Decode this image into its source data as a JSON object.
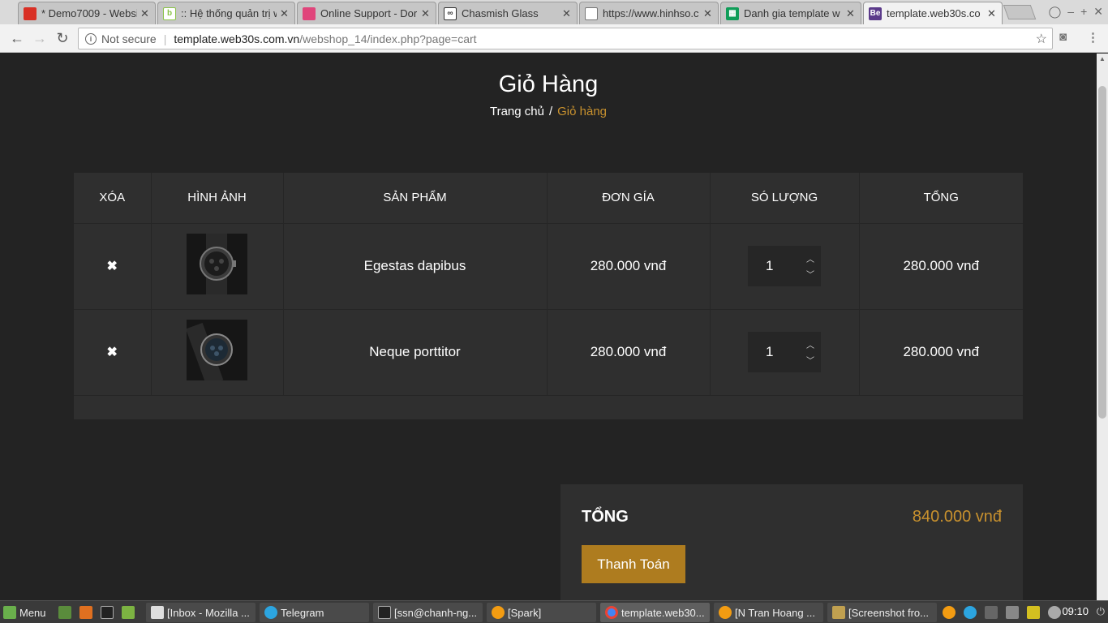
{
  "browser": {
    "tabs": [
      {
        "label": "* Demo7009 - Websi",
        "icon": "red-favicon",
        "color": "#d93025"
      },
      {
        "label": ":: Hệ thống quản trị w",
        "icon": "green-b-favicon",
        "color": "#8bc34a"
      },
      {
        "label": "Online Support - Dor",
        "icon": "pink-favicon",
        "color": "#e0457b"
      },
      {
        "label": "Chasmish Glass",
        "icon": "glasses-favicon",
        "color": "#333333"
      },
      {
        "label": "https://www.hinhso.c",
        "icon": "page-favicon",
        "color": "#777777"
      },
      {
        "label": "Danh gia template w",
        "icon": "sheets-favicon",
        "color": "#0f9d58"
      },
      {
        "label": "template.web30s.co",
        "icon": "be-favicon",
        "color": "#5b3a8a"
      }
    ],
    "address": {
      "security": "Not secure",
      "host": "template.web30s.com.vn",
      "path": "/webshop_14/index.php?page=cart"
    }
  },
  "page": {
    "title": "Giỏ Hàng",
    "breadcrumb": {
      "home": "Trang chủ",
      "separator": "/",
      "current": "Giỏ hàng"
    },
    "cart": {
      "headers": [
        "XÓA",
        "HÌNH ẢNH",
        "SẢN PHẨM",
        "ĐƠN GÍA",
        "SÓ LƯỢNG",
        "TỔNG"
      ],
      "rows": [
        {
          "remove": "✖",
          "product": "Egestas dapibus",
          "price": "280.000 vnđ",
          "qty": "1",
          "total": "280.000 vnđ"
        },
        {
          "remove": "✖",
          "product": "Neque porttitor",
          "price": "280.000 vnđ",
          "qty": "1",
          "total": "280.000 vnđ"
        }
      ]
    },
    "summary": {
      "label": "TỔNG",
      "value": "840.000 vnđ",
      "checkout": "Thanh Toán"
    }
  },
  "taskbar": {
    "menu": "Menu",
    "tasks": [
      "[Inbox - Mozilla ...",
      "Telegram",
      "[ssn@chanh-ng...",
      "[Spark]",
      "template.web30...",
      "[N Tran Hoang ...",
      "[Screenshot fro..."
    ],
    "clock": "09:10"
  },
  "colors": {
    "accent": "#c8912e",
    "button": "#ae7c1f",
    "background": "#232323",
    "panel": "#2f2f2f"
  }
}
